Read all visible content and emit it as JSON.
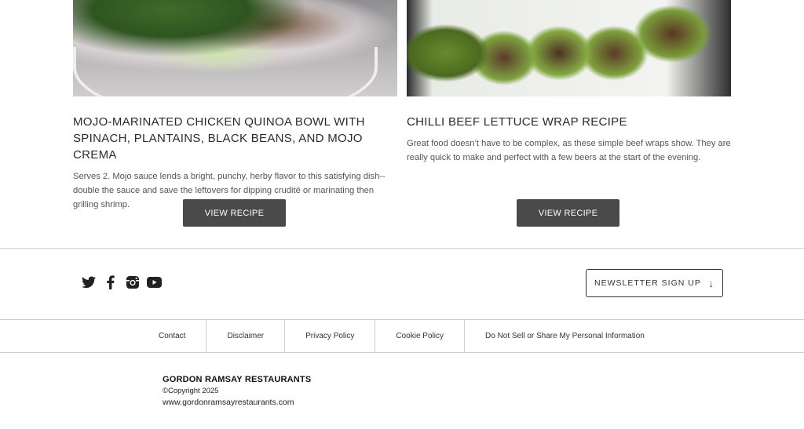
{
  "recipes": [
    {
      "title": "MOJO-MARINATED CHICKEN QUINOA BOWL WITH SPINACH, PLANTAINS, BLACK BEANS, AND MOJO CREMA",
      "description": "Serves 2. Mojo sauce lends a bright, punchy, herby flavor to this satisfying dish--double the sauce and save the leftovers for dipping crudité or marinating then grilling shrimp.",
      "button_label": "VIEW RECIPE"
    },
    {
      "title": "CHILLI BEEF LETTUCE WRAP RECIPE",
      "description": "Great food doesn’t have to be complex, as these simple beef wraps show. They are really quick to make and perfect with a few beers at the start of the evening.",
      "button_label": "VIEW RECIPE"
    }
  ],
  "social": {
    "icons": [
      "twitter-icon",
      "facebook-icon",
      "instagram-icon",
      "youtube-icon"
    ]
  },
  "newsletter": {
    "label": "NEWSLETTER SIGN UP",
    "arrow": "↓"
  },
  "footer_links": [
    "Contact",
    "Disclaimer",
    "Privacy Policy",
    "Cookie Policy",
    "Do Not Sell or Share My Personal Information"
  ],
  "company": {
    "name": "GORDON RAMSAY RESTAURANTS",
    "copyright": "©Copyright 2025",
    "website": "www.gordonramsayrestaurants.com"
  },
  "colors": {
    "button_bg": "#4a4a4a",
    "divider": "#cfcfcf",
    "text": "#222222"
  }
}
